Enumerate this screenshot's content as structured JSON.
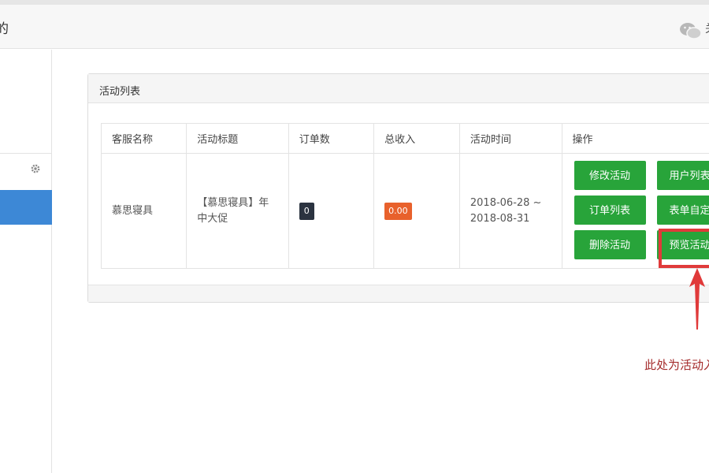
{
  "header": {
    "title": "的",
    "extra": "关",
    "icon": "wechat-icon"
  },
  "sidebar": {
    "gear_icon": "gear-icon"
  },
  "panel": {
    "title": "活动列表"
  },
  "table": {
    "columns": [
      "客服名称",
      "活动标题",
      "订单数",
      "总收入",
      "活动时间",
      "操作"
    ],
    "rows": [
      {
        "service_name": "慕思寝具",
        "activity_title": "【慕思寝具】年中大促",
        "order_count": "0",
        "total_income": "0.00",
        "activity_time": "2018-06-28 ~ 2018-08-31"
      }
    ]
  },
  "actions": {
    "edit": "修改活动",
    "user_list": "用户列表",
    "order_list": "订单列表",
    "form_custom": "表单自定义",
    "delete": "删除活动",
    "preview": "预览活动"
  },
  "annotation": {
    "note": "此处为活动入口"
  },
  "colors": {
    "button": "#28a43a",
    "active": "#3d88d6",
    "highlight": "#e03a3a",
    "note": "#a42a2a"
  }
}
